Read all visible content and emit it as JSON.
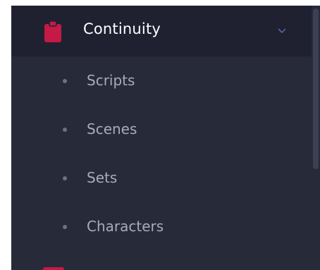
{
  "menu": {
    "title": "Continuity",
    "icon": "clipboard-icon",
    "chevron": "chevron-down-icon",
    "accent_color": "#c41a45",
    "items": [
      {
        "label": "Scripts"
      },
      {
        "label": "Scenes"
      },
      {
        "label": "Sets"
      },
      {
        "label": "Characters"
      }
    ]
  }
}
